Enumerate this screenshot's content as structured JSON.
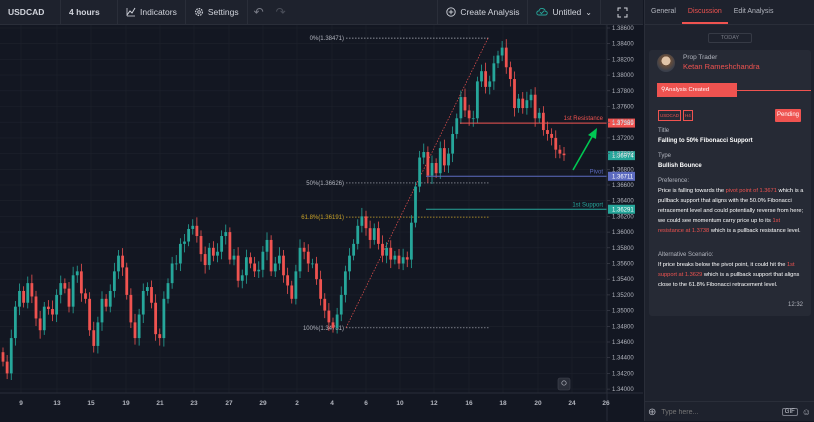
{
  "toolbar": {
    "symbol": "USDCAD",
    "interval": "4 hours",
    "indicators": "Indicators",
    "settings": "Settings",
    "create_analysis": "Create Analysis",
    "untitled": "Untitled"
  },
  "panel": {
    "tabs": [
      "General",
      "Discussion",
      "Edit Analysis"
    ],
    "today": "TODAY",
    "author_role": "Prop Trader",
    "author_name": "Ketan Rameshchandra",
    "status_created": "Analysis Created",
    "badges": [
      "USDCAD",
      "H4"
    ],
    "status": "Pending",
    "title_label": "Title",
    "title": "Falling to 50% Fibonacci Support",
    "type_label": "Type",
    "type": "Bullish Bounce",
    "preference_label": "Preference:",
    "preference": {
      "p1": "Price is falling towards the ",
      "h1": "pivot point of 1.3671",
      "p2": " which is a pullback support that aligns with the 50.0% Fibonacci retracement level and could potentially reverse from here; we could see momentum carry price up to its ",
      "h2": "1st resistance at 1.3738",
      "p3": " which is a pullback resistance level."
    },
    "alt_label": "Alternative Scenario:",
    "alt": {
      "p1": "If price breaks below the pivot point, it could hit the ",
      "h1": "1st support at 1.3629",
      "p2": " which is a pullback support that aligns close to the 61.8% Fibonacci retracement level."
    },
    "time": "12:32",
    "input_placeholder": "Type here...",
    "gif": "GIF"
  },
  "chart_data": {
    "type": "candlestick",
    "symbol": "USDCAD",
    "interval": "4 hours",
    "y_ticks": [
      "1.38600",
      "1.38400",
      "1.38200",
      "1.38000",
      "1.37800",
      "1.37600",
      "1.37400",
      "1.37200",
      "1.37000",
      "1.36800",
      "1.36600",
      "1.36400",
      "1.36200",
      "1.36000",
      "1.35800",
      "1.35600",
      "1.35400",
      "1.35200",
      "1.35000",
      "1.34800",
      "1.34600",
      "1.34400",
      "1.34200",
      "1.34000"
    ],
    "x_ticks": [
      "9",
      "13",
      "15",
      "19",
      "21",
      "23",
      "27",
      "29",
      "2",
      "4",
      "6",
      "10",
      "12",
      "16",
      "18",
      "20",
      "24",
      "26"
    ],
    "fib_levels": [
      {
        "label": "0%(1.38471)",
        "value": 1.38471
      },
      {
        "label": "50%(1.36626)",
        "value": 1.36626
      },
      {
        "label": "61.8%(1.36191)",
        "value": 1.36191
      },
      {
        "label": "100%(1.34781)",
        "value": 1.34781
      }
    ],
    "levels": [
      {
        "name": "1st Resistance",
        "value": 1.37389,
        "price_label": "1.37389",
        "color": "#ef5350"
      },
      {
        "name": "Pivot",
        "value": 1.36711,
        "price_label": "1.36711",
        "color": "#5c6bc0"
      },
      {
        "name": "1st Support",
        "value": 1.36291,
        "price_label": "1.36291",
        "color": "#26a69a"
      }
    ],
    "last_price": {
      "value": 1.36974,
      "label": "1.36974"
    },
    "closes": [
      1.3435,
      1.342,
      1.3465,
      1.3505,
      1.3525,
      1.351,
      1.3535,
      1.3518,
      1.349,
      1.3475,
      1.3505,
      1.3502,
      1.3495,
      1.352,
      1.3535,
      1.3528,
      1.3505,
      1.3545,
      1.355,
      1.3522,
      1.3515,
      1.3475,
      1.3455,
      1.3485,
      1.3515,
      1.3505,
      1.3525,
      1.355,
      1.357,
      1.3555,
      1.352,
      1.3485,
      1.3465,
      1.3495,
      1.3525,
      1.353,
      1.351,
      1.347,
      1.3465,
      1.3515,
      1.3535,
      1.356,
      1.356,
      1.3585,
      1.3588,
      1.3604,
      1.3608,
      1.3595,
      1.3572,
      1.3558,
      1.358,
      1.357,
      1.3575,
      1.3595,
      1.36,
      1.3565,
      1.357,
      1.3538,
      1.3545,
      1.3568,
      1.356,
      1.355,
      1.3552,
      1.3575,
      1.359,
      1.355,
      1.356,
      1.357,
      1.3545,
      1.3532,
      1.3515,
      1.355,
      1.358,
      1.3575,
      1.356,
      1.356,
      1.354,
      1.3515,
      1.35,
      1.3485,
      1.3478,
      1.3495,
      1.352,
      1.355,
      1.357,
      1.3585,
      1.3608,
      1.362,
      1.3605,
      1.359,
      1.3605,
      1.3585,
      1.357,
      1.358,
      1.3565,
      1.357,
      1.356,
      1.3568,
      1.3565,
      1.3612,
      1.3658,
      1.3695,
      1.3702,
      1.3672,
      1.3688,
      1.3675,
      1.3707,
      1.3685,
      1.37,
      1.3725,
      1.3745,
      1.3772,
      1.3755,
      1.3745,
      1.3745,
      1.3792,
      1.3805,
      1.3785,
      1.3792,
      1.3815,
      1.3825,
      1.3835,
      1.381,
      1.3795,
      1.3758,
      1.377,
      1.3758,
      1.3768,
      1.3775,
      1.3745,
      1.3752,
      1.373,
      1.3725,
      1.372,
      1.3705,
      1.37,
      1.3698
    ]
  }
}
